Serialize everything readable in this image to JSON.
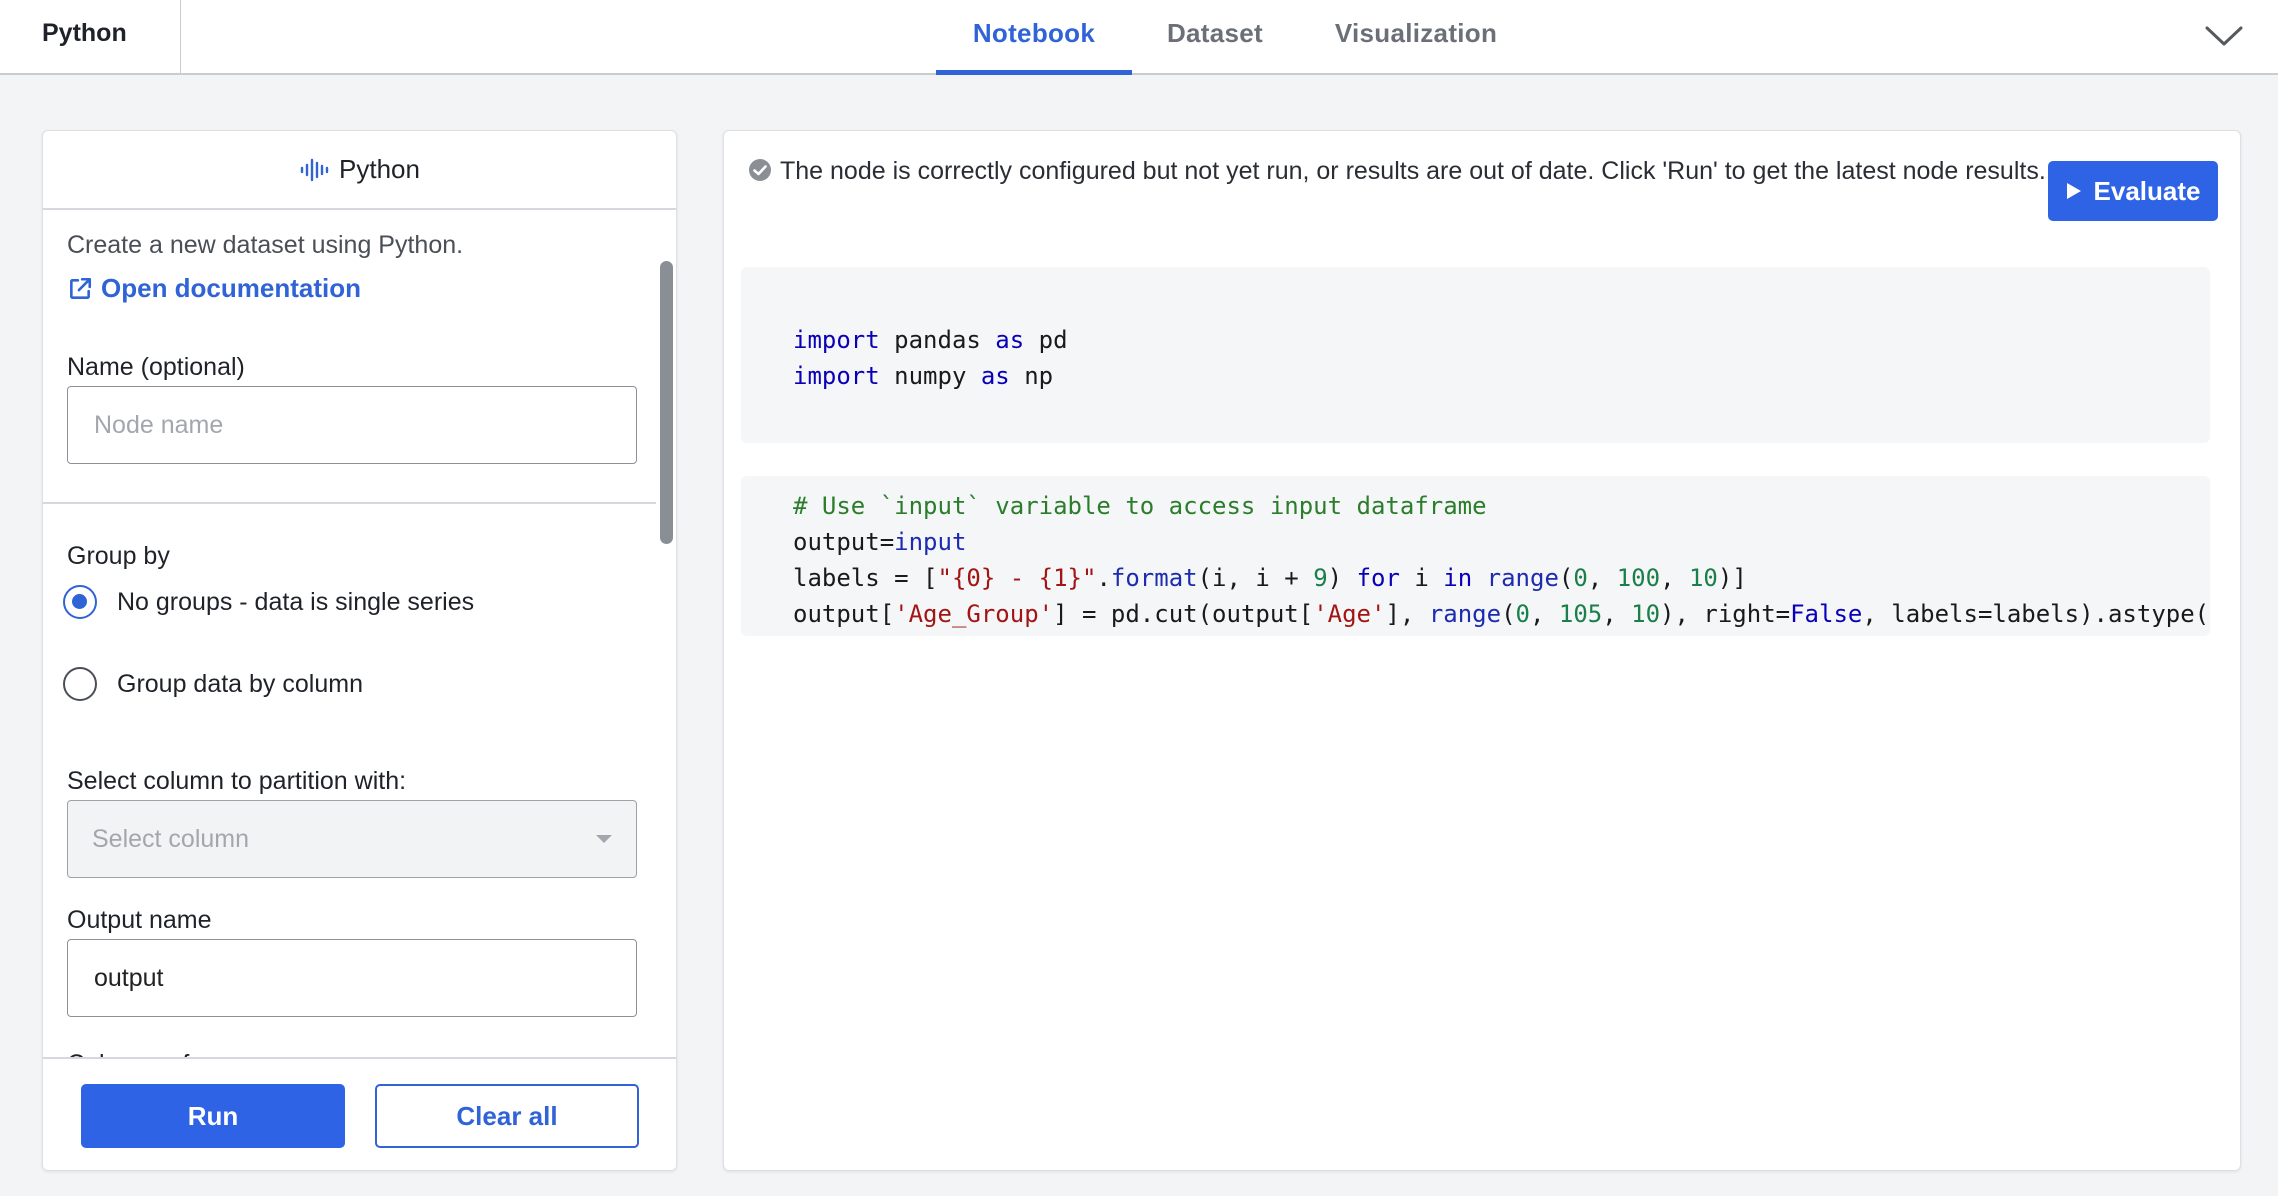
{
  "topbar": {
    "app_title": "Python",
    "tabs": [
      {
        "label": "Notebook",
        "active": true
      },
      {
        "label": "Dataset",
        "active": false
      },
      {
        "label": "Visualization",
        "active": false
      }
    ],
    "collapse_icon": "chevron-down-icon"
  },
  "left_panel": {
    "header_title": "Python",
    "header_icon": "audio-wave-icon",
    "description": "Create a new dataset using Python.",
    "doc_link": "Open documentation",
    "name_label": "Name (optional)",
    "name_placeholder": "Node name",
    "name_value": "",
    "group_by_label": "Group by",
    "group_options": [
      {
        "label": "No groups - data is single series",
        "checked": true
      },
      {
        "label": "Group data by column",
        "checked": false
      }
    ],
    "partition_label": "Select column to partition with:",
    "partition_placeholder": "Select column",
    "output_label": "Output name",
    "output_value": "output",
    "cutoff_label": "Column reference",
    "run_label": "Run",
    "clear_label": "Clear all"
  },
  "right_panel": {
    "status_message": "The node is correctly configured but not yet run, or results are out of date. Click 'Run' to get the latest node results.",
    "evaluate_label": "Evaluate",
    "cells": [
      {
        "lines": [
          "import pandas as pd",
          "import numpy as np"
        ]
      },
      {
        "lines": [
          "# Use `input` variable to access input dataframe",
          "output=input",
          "labels = [\"{0} - {1}\".format(i, i + 9) for i in range(0, 100, 10)]",
          "output['Age_Group'] = pd.cut(output['Age'], range(0, 105, 10), right=False, labels=labels).astype("
        ]
      }
    ]
  },
  "colors": {
    "accent": "#2f63d6",
    "button_primary": "#2f63e6",
    "background": "#f3f4f6"
  }
}
